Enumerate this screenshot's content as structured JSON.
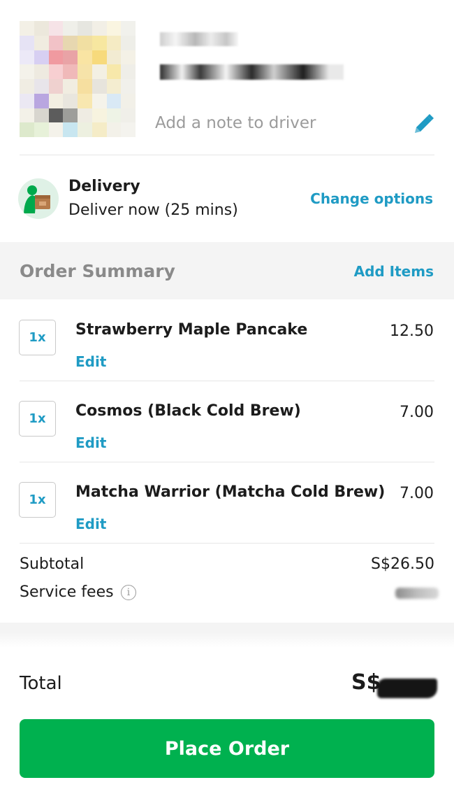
{
  "address": {
    "note_placeholder": "Add a note to driver"
  },
  "delivery": {
    "title": "Delivery",
    "subtitle": "Deliver now (25 mins)",
    "change_options_label": "Change options"
  },
  "order_summary": {
    "title": "Order Summary",
    "add_items_label": "Add Items",
    "items": [
      {
        "qty": "1x",
        "name": "Strawberry Maple Pancake",
        "price": "12.50",
        "edit_label": "Edit"
      },
      {
        "qty": "1x",
        "name": "Cosmos (Black Cold Brew)",
        "price": "7.00",
        "edit_label": "Edit"
      },
      {
        "qty": "1x",
        "name": "Matcha Warrior (Matcha Cold Brew)",
        "price": "7.00",
        "edit_label": "Edit"
      }
    ]
  },
  "totals": {
    "subtotal_label": "Subtotal",
    "subtotal_value": "S$26.50",
    "service_fees_label": "Service fees",
    "service_fees_info_glyph": "i",
    "total_label": "Total",
    "total_value_visible": "S$"
  },
  "actions": {
    "place_order_label": "Place Order"
  },
  "colors": {
    "accent_link": "#1f9bc4",
    "primary_button": "#00b14f",
    "band_background": "#f4f4f4",
    "muted_text": "#9b9b9b"
  },
  "icons": {
    "edit_note": "pencil-icon",
    "delivery": "delivery-rider-icon",
    "service_fee_info": "info-icon"
  }
}
